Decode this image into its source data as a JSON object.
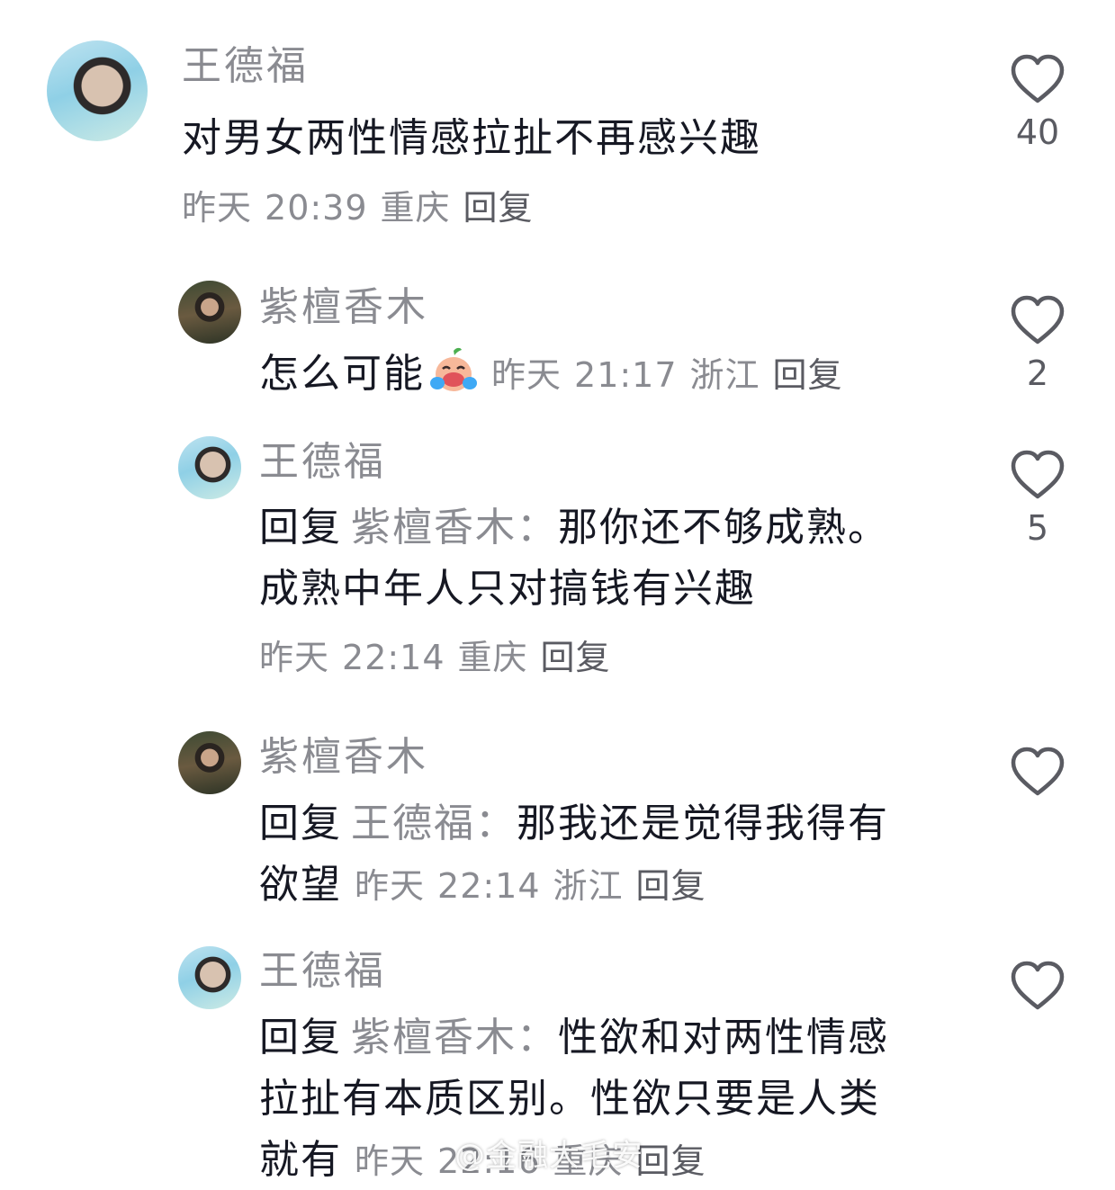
{
  "comments": [
    {
      "author": "王德福",
      "text": "对男女两性情感拉扯不再感兴趣",
      "date": "昨天",
      "time": "20:39",
      "location": "重庆",
      "reply_label": "回复",
      "likes": "40"
    },
    {
      "author": "紫檀香木",
      "text": "怎么可能",
      "emoji": "laughing-tears-emoji",
      "date": "昨天",
      "time": "21:17",
      "location": "浙江",
      "reply_label": "回复",
      "likes": "2"
    },
    {
      "author": "王德福",
      "reply_prefix": "回复",
      "reply_to": "紫檀香木：",
      "text_line1": "那你还不够成熟。",
      "text_line2": "成熟中年人只对搞钱有兴趣",
      "date": "昨天",
      "time": "22:14",
      "location": "重庆",
      "reply_label": "回复",
      "likes": "5"
    },
    {
      "author": "紫檀香木",
      "reply_prefix": "回复",
      "reply_to": "王德福：",
      "text_line1": "那我还是觉得我得有",
      "text_line2": "欲望",
      "date": "昨天",
      "time": "22:14",
      "location": "浙江",
      "reply_label": "回复"
    },
    {
      "author": "王德福",
      "reply_prefix": "回复",
      "reply_to": "紫檀香木：",
      "text_line1": "性欲和对两性情感",
      "text_line2": "拉扯有本质区别。性欲只要是人类",
      "text_line3": "就有",
      "date": "昨天",
      "time": "22:16",
      "location": "重庆",
      "reply_label": "回复"
    }
  ],
  "watermark": "@金融大毛安",
  "colors": {
    "text": "#161823",
    "muted": "#8a8b91",
    "icon": "#5a5b62"
  }
}
